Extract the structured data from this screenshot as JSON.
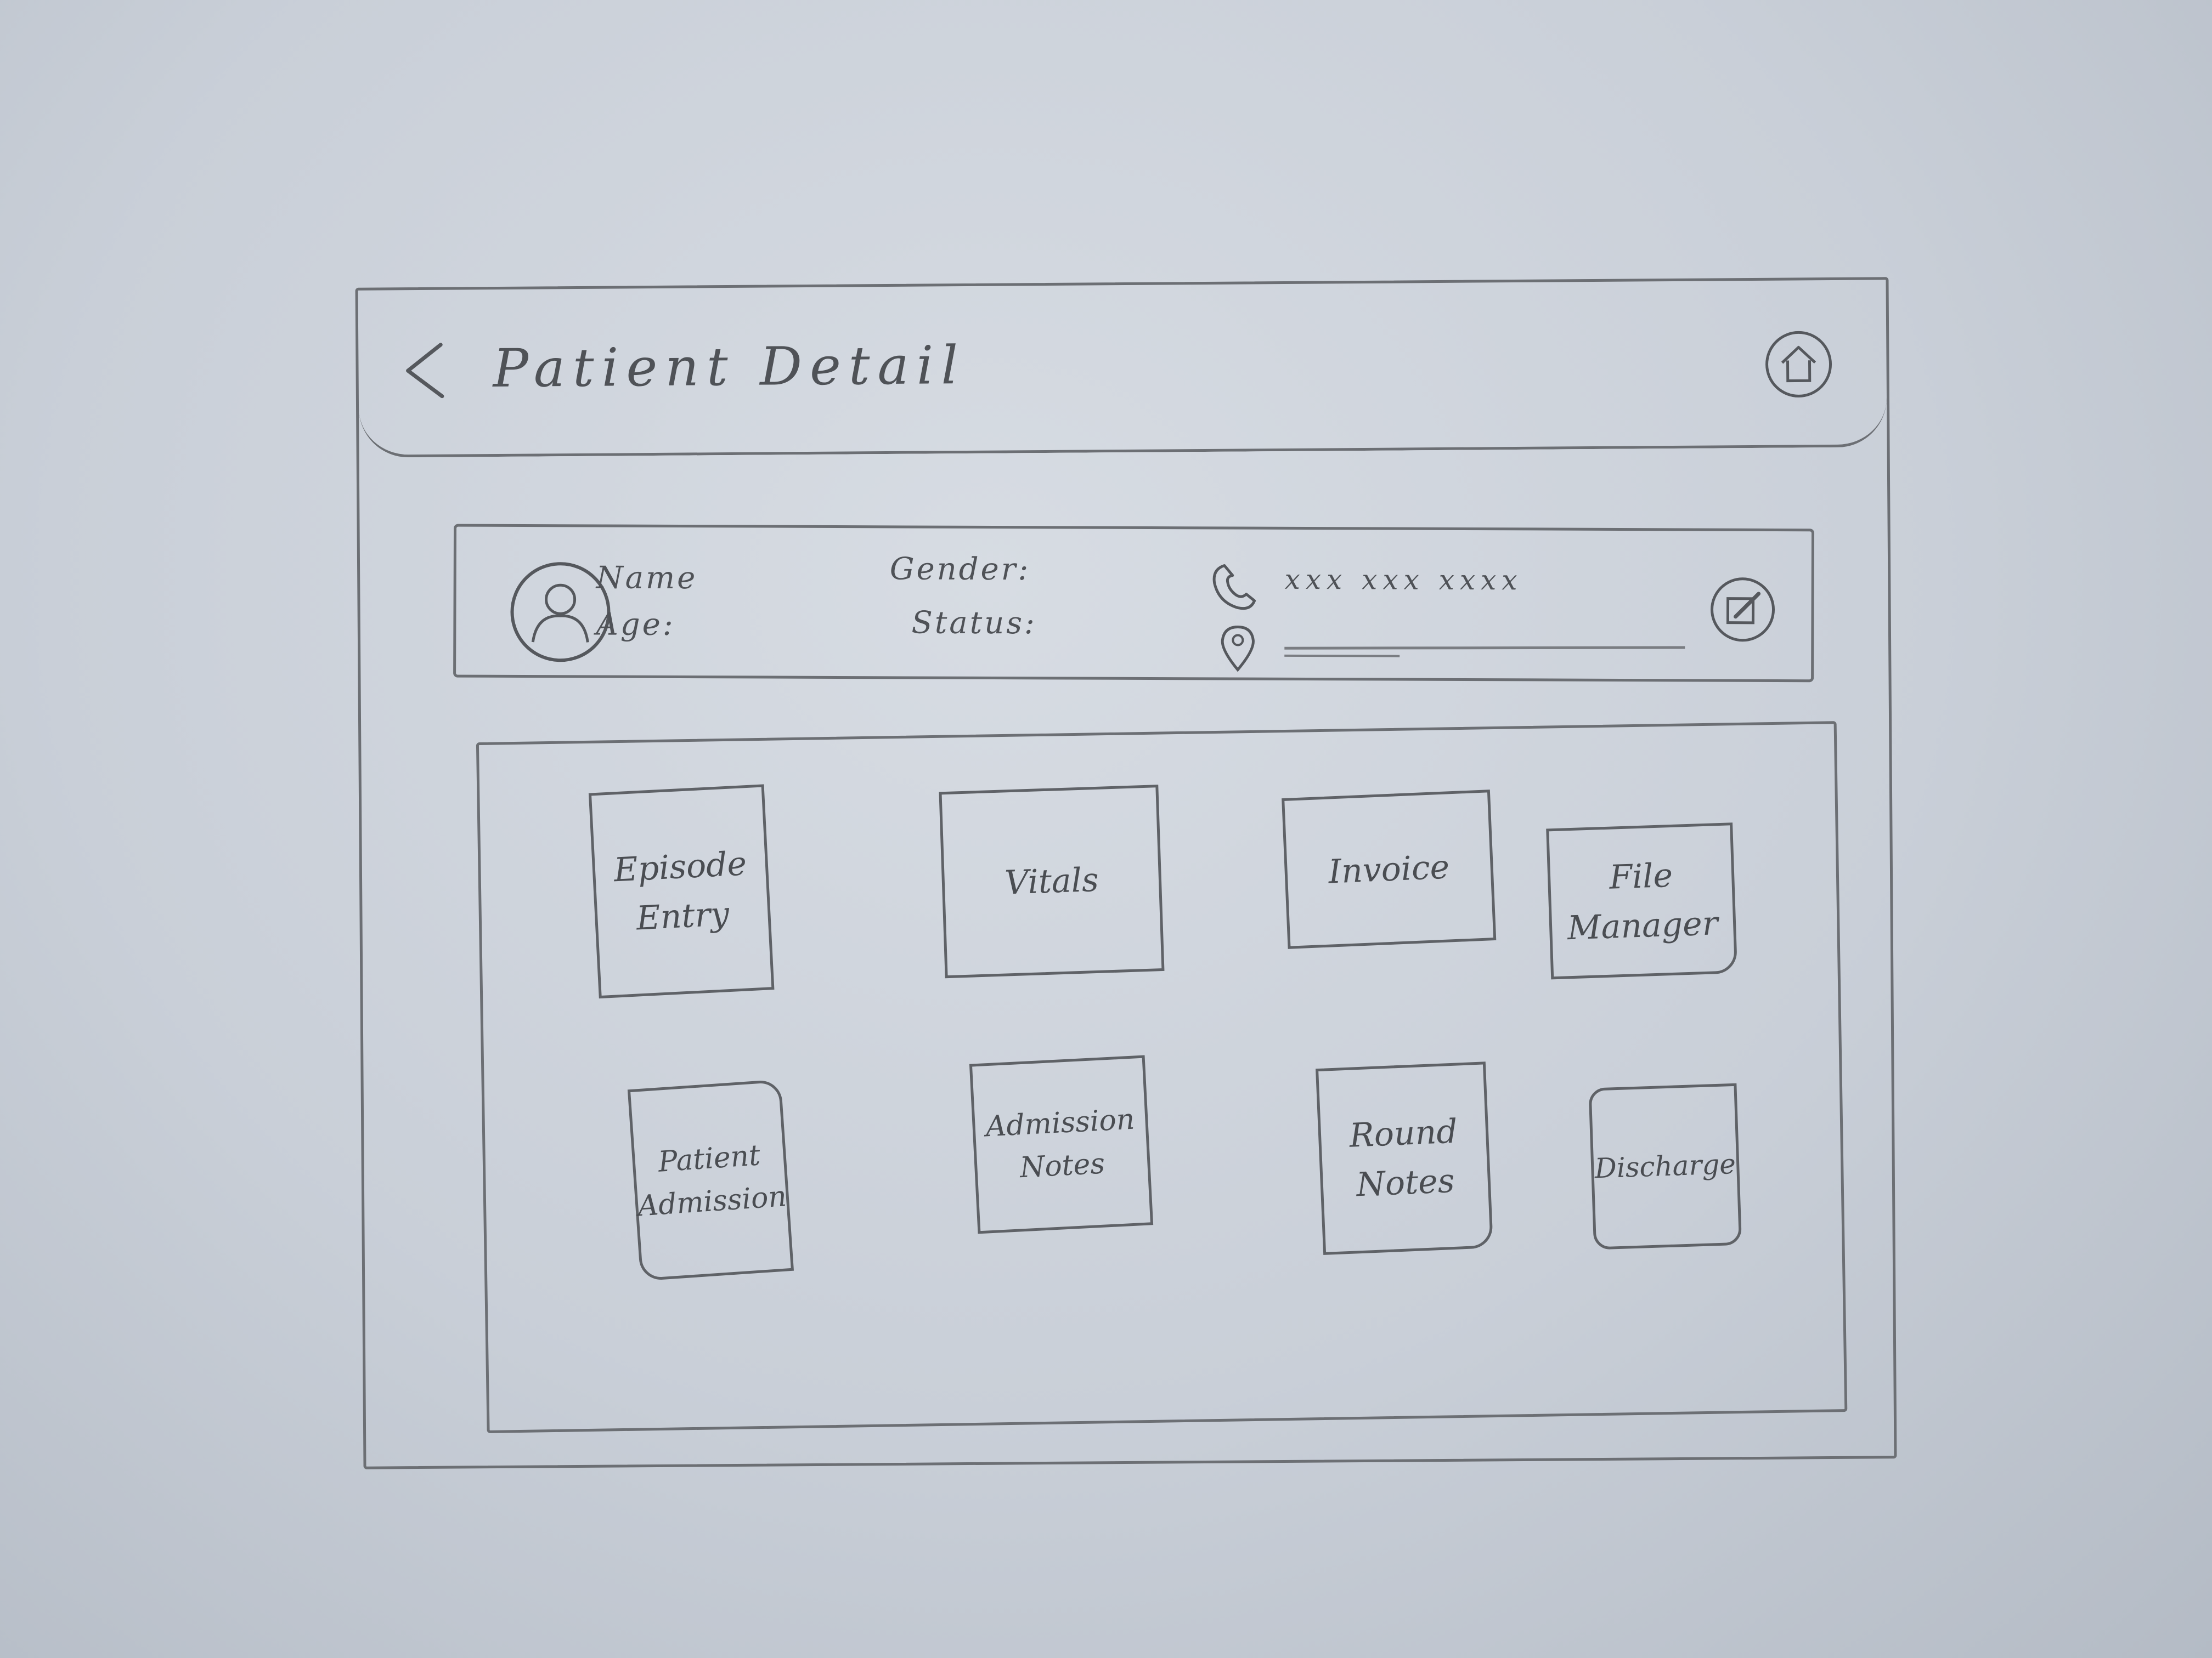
{
  "header": {
    "title": "Patient Detail",
    "back_icon": "chevron-left-icon",
    "home_icon": "home-icon"
  },
  "patient": {
    "name_label": "Name",
    "age_label": "Age:",
    "gender_label": "Gender:",
    "status_label": "Status:",
    "phone": "xxx xxx xxxx",
    "avatar_icon": "user-avatar-icon",
    "phone_icon": "phone-icon",
    "location_icon": "location-pin-icon",
    "edit_icon": "edit-icon"
  },
  "tiles": [
    {
      "line1": "Episode",
      "line2": "Entry"
    },
    {
      "line1": "Vitals",
      "line2": ""
    },
    {
      "line1": "Invoice",
      "line2": ""
    },
    {
      "line1": "File",
      "line2": "Manager"
    },
    {
      "line1": "Patient",
      "line2": "Admission"
    },
    {
      "line1": "Admission",
      "line2": "Notes"
    },
    {
      "line1": "Round",
      "line2": "Notes"
    },
    {
      "line1": "Discharge",
      "line2": ""
    }
  ],
  "colors": {
    "paper": "#cfd4dc",
    "pencil": "#6c6f74"
  }
}
